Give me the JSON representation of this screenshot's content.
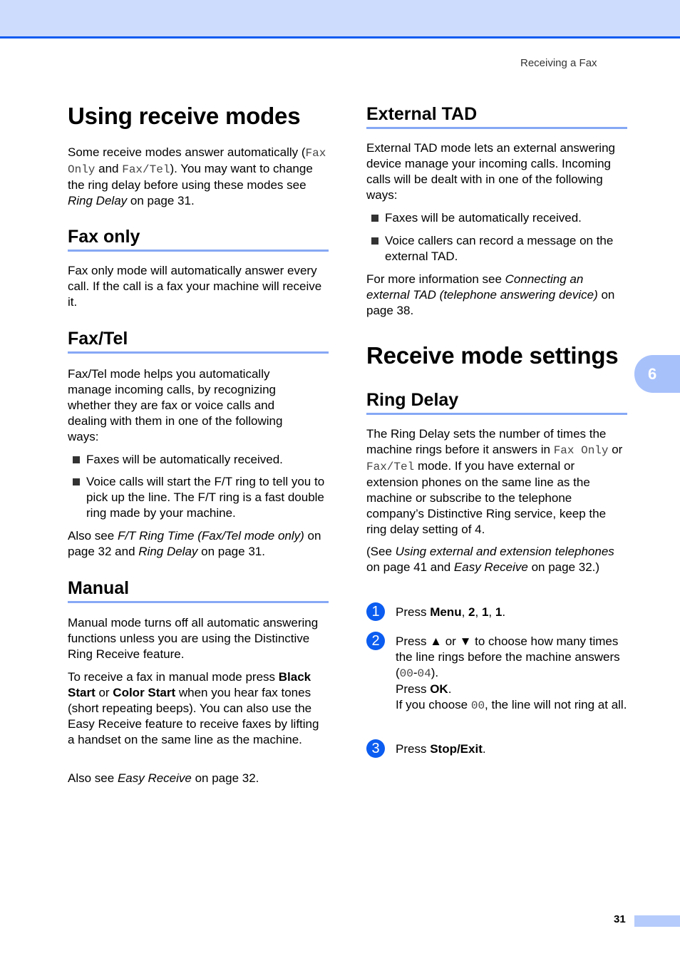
{
  "header": {
    "running_title": "Receiving a Fax"
  },
  "side_tab": {
    "chapter": "6"
  },
  "footer": {
    "page_number": "31"
  },
  "left": {
    "title": "Using receive modes",
    "intro": {
      "t1": "Some receive modes answer automatically (",
      "m1": "Fax Only",
      "t2": " and ",
      "m2": "Fax/Tel",
      "t3": "). You may want to change the ring delay before using these modes see ",
      "i1": "Ring Delay",
      "t4": " on page 31."
    },
    "fax_only": {
      "heading": "Fax only",
      "body": "Fax only mode will automatically answer every call. If the call is a fax your machine will receive it."
    },
    "fax_tel": {
      "heading": "Fax/Tel",
      "body": "Fax/Tel mode helps you automatically manage incoming calls, by recognizing whether they are fax or voice calls and dealing with them in one of the following ways:",
      "bullets": [
        "Faxes will be automatically received.",
        "Voice calls will start the F/T ring to tell you to pick up the line. The F/T ring is a fast double ring made by your machine."
      ],
      "also": {
        "t1": "Also see ",
        "i1": "F/T Ring Time (Fax/Tel mode only)",
        "t2": " on page 32 and ",
        "i2": "Ring Delay",
        "t3": " on page 31."
      }
    },
    "manual": {
      "heading": "Manual",
      "body1": "Manual mode turns off all automatic answering functions unless you are using the Distinctive Ring Receive feature.",
      "body2": {
        "t1": "To receive a fax in manual mode press ",
        "b1": "Black Start",
        "t2": " or ",
        "b2": "Color Start",
        "t3": " when you hear fax tones (short repeating beeps). You can also use the Easy Receive feature to receive faxes by lifting a handset on the same line as the machine."
      },
      "also": {
        "t1": "Also see ",
        "i1": "Easy Receive",
        "t2": " on page 32."
      }
    }
  },
  "right": {
    "external_tad": {
      "heading": "External TAD",
      "body": "External TAD mode lets an external answering device manage your incoming calls. Incoming calls will be dealt with in one of the following ways:",
      "bullets": [
        "Faxes will be automatically received.",
        "Voice callers can record a message on the external TAD."
      ],
      "more": {
        "t1": "For more information see ",
        "i1": "Connecting an external TAD (telephone answering device)",
        "t2": " on page 38."
      }
    },
    "settings_title": "Receive mode settings",
    "ring_delay": {
      "heading": "Ring Delay",
      "body": {
        "t1": "The Ring Delay sets the number of times the machine rings before it answers in ",
        "m1": "Fax Only",
        "t2": " or ",
        "m2": "Fax/Tel",
        "t3": " mode. If you have external or extension phones on the same line as the machine or subscribe to the telephone company’s Distinctive Ring service, keep the ring delay setting of 4."
      },
      "see": {
        "t1": "(See ",
        "i1": "Using external and extension telephones",
        "t2": " on page 41 and ",
        "i2": "Easy Receive",
        "t3": " on page 32.)"
      },
      "steps": [
        {
          "num": "1",
          "t1": "Press ",
          "b1": "Menu",
          "t2": ", ",
          "b2": "2",
          "t3": ", ",
          "b3": "1",
          "t4": ", ",
          "b4": "1",
          "t5": "."
        },
        {
          "num": "2",
          "t1": "Press ▲ or ▼ to choose how many times the line rings before the machine answers (",
          "m1": "00",
          "t2": "-",
          "m2": "04",
          "t3": ").",
          "t4": "Press ",
          "b1": "OK",
          "t5": ".",
          "t6": "If you choose ",
          "m3": "00",
          "t7": ", the line will not ring at all."
        },
        {
          "num": "3",
          "t1": "Press ",
          "b1": "Stop/Exit",
          "t2": "."
        }
      ]
    }
  }
}
